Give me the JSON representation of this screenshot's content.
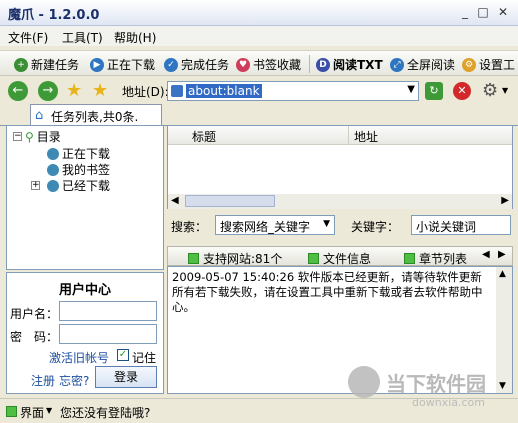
{
  "window": {
    "title": "魔爪 - 1.2.0.0"
  },
  "menu": [
    "文件(F)",
    "工具(T)",
    "帮助(H)"
  ],
  "toolbar": {
    "new_task": "新建任务",
    "downloading": "正在下载",
    "completed": "完成任务",
    "bookmarks": "书签收藏",
    "read_txt": "阅读TXT",
    "fullscreen_read": "全屏阅读",
    "settings": "设置工"
  },
  "address": {
    "label": "地址(D):",
    "value": "about:blank"
  },
  "tab": {
    "label": "任务列表,共0条."
  },
  "tree": {
    "root": "目录",
    "items": [
      "正在下载",
      "我的书签",
      "已经下载"
    ]
  },
  "user_center": {
    "title": "用户中心",
    "username_label": "用户名：",
    "password_label": "密　码：",
    "activate_link": "激活旧帐号",
    "remember_label": "记住",
    "register_link": "注册",
    "forgot_link": "忘密?",
    "login_button": "登录"
  },
  "grid": {
    "headers": [
      "标题",
      "地址"
    ]
  },
  "search": {
    "label": "搜索：",
    "engine": "搜索网络_关键字",
    "keyword_label": "关键字：",
    "keyword_value": "小说关键词"
  },
  "subtabs": [
    "支持网站:81个",
    "文件信息",
    "章节列表"
  ],
  "log": {
    "text": "2009-05-07 15:40:26 软件版本已经更新，请等待软件更新所有若下载失败，请在设置工具中重新下载或者去软件帮助中心。"
  },
  "status": {
    "skin": "界面",
    "message": "您还没有登陆哦?"
  },
  "watermark": {
    "cn": "当下软件园",
    "en": "downxia.com"
  }
}
